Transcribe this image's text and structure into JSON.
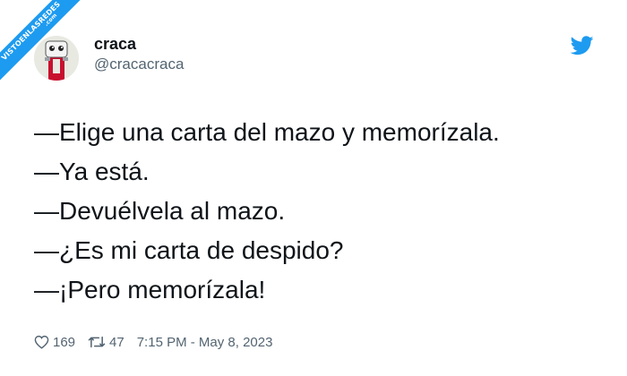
{
  "watermark": {
    "text": "VISTOENLASREDES",
    "sub": ".com"
  },
  "author": {
    "display_name": "craca",
    "handle": "@cracacraca"
  },
  "tweet": {
    "lines": [
      "—Elige una carta del mazo y memorízala.",
      "—Ya está.",
      "—Devuélvela al mazo.",
      "—¿Es mi carta de despido?",
      "—¡Pero memorízala!"
    ]
  },
  "footer": {
    "likes": "169",
    "retweets": "47",
    "timestamp": "7:15 PM - May 8, 2023"
  },
  "icons": {
    "brand": "twitter-bird-icon",
    "like": "heart-icon",
    "retweet": "retweet-icon"
  },
  "colors": {
    "brand": "#1d9bf0",
    "text": "#0f1419",
    "muted": "#536471"
  }
}
